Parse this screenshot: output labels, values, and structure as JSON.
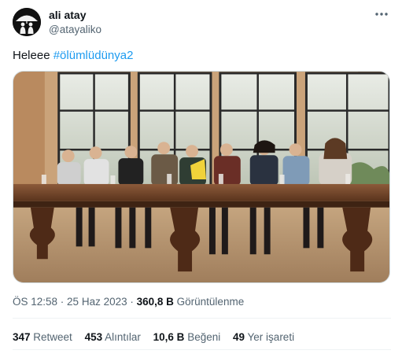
{
  "author": {
    "name": "ali atay",
    "handle": "@atayaliko",
    "avatar_icon": "umbrella-people-avatar-icon"
  },
  "menu_icon": "more-dots-icon",
  "tweet": {
    "text": "Heleee ",
    "hashtag": "#ölümlüdünya2"
  },
  "media": {
    "description": "Group photo: cast seated at a long wooden table in front of large windows",
    "people_count": 10
  },
  "meta": {
    "time": "ÖS 12:58",
    "separator1": " · ",
    "date": "25 Haz 2023",
    "separator2": " · ",
    "views_count": "360,8 B",
    "views_label": " Görüntülenme"
  },
  "stats": {
    "retweets_count": "347",
    "retweets_label": " Retweet",
    "quotes_count": "453",
    "quotes_label": " Alıntılar",
    "likes_count": "10,6 B",
    "likes_label": " Beğeni",
    "bookmarks_count": "49",
    "bookmarks_label": " Yer işareti"
  },
  "colors": {
    "link": "#1d9bf0",
    "secondary_text": "#536471",
    "primary_text": "#0f1419",
    "border": "#cfd9de"
  }
}
